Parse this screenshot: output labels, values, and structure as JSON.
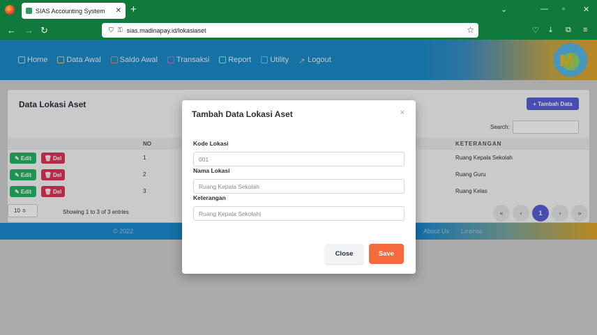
{
  "browser": {
    "tab_title": "SIAS Accounting System",
    "tab_close": "✕",
    "new_tab": "+",
    "url": "sias.madinapay.id/lokasiaset"
  },
  "menu": [
    {
      "label": "Home",
      "icon": "home-icon"
    },
    {
      "label": "Data Awal",
      "icon": "monitor-icon"
    },
    {
      "label": "Saldo Awal",
      "icon": "copy-icon"
    },
    {
      "label": "Transaksi",
      "icon": "calculator-icon"
    },
    {
      "label": "Report",
      "icon": "window-icon"
    },
    {
      "label": "Utility",
      "icon": "tools-icon"
    },
    {
      "label": "Logout",
      "icon": "logout-icon"
    }
  ],
  "card": {
    "title": "Data Lokasi Aset",
    "add_button": "+ Tambah Data",
    "search_label": "Search:"
  },
  "table": {
    "columns": {
      "no": "NO",
      "keterangan": "KETERANGAN"
    },
    "edit_label": "✎ Edit",
    "del_label": "🗑 Del",
    "rows": [
      {
        "no": "1",
        "keterangan": "Ruang Kepala Sekolah"
      },
      {
        "no": "2",
        "keterangan": "Ruang Guru"
      },
      {
        "no": "3",
        "keterangan": "Ruang Kelas"
      }
    ],
    "page_size": "10 ≑",
    "info": "Showing 1 to 3 of 3 entries",
    "pagination": [
      "«",
      "‹",
      "1",
      "›",
      "»"
    ]
  },
  "footer": {
    "copyright": "© 2022",
    "about": "About Us",
    "license": "License"
  },
  "modal": {
    "title": "Tambah Data Lokasi Aset",
    "close_x": "×",
    "fields": [
      {
        "label": "Kode Lokasi",
        "value": "001"
      },
      {
        "label": "Nama Lokasi",
        "value": "Ruang Kepala Sekolah"
      },
      {
        "label": "Keterangan",
        "value": "Ruang Kepala Sekolah|"
      }
    ],
    "close_button": "Close",
    "save_button": "Save"
  }
}
